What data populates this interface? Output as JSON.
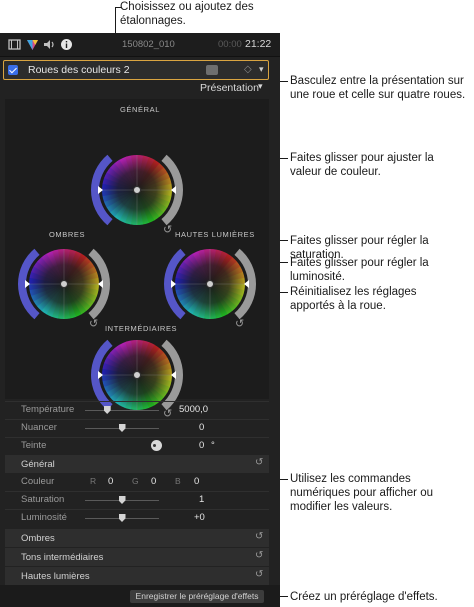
{
  "annotations": {
    "corrections": "Choisissez ou ajoutez des étalonnages.",
    "presentation": "Basculez entre la présentation sur une roue et celle sur quatre roues.",
    "color_value": "Faites glisser pour ajuster la valeur de couleur.",
    "saturation": "Faites glisser pour régler la saturation.",
    "luminosity": "Faites glisser pour régler la luminosité.",
    "reset": "Réinitialisez les réglages apportés à la roue.",
    "numeric": "Utilisez les commandes numériques pour afficher ou modifier les valeurs.",
    "preset": "Créez un préréglage d'effets."
  },
  "topbar": {
    "clip_name": "150802_010",
    "timecode_dim": "00:00",
    "timecode": "21:22",
    "icons": [
      "film-icon",
      "color-board-icon",
      "audio-icon",
      "info-icon"
    ]
  },
  "correction": {
    "label": "Roues des couleurs 2",
    "checked": true
  },
  "presentation_label": "Présentation",
  "wheels": {
    "general": "GÉNÉRAL",
    "shadows": "OMBRES",
    "highlights": "HAUTES LUMIÈRES",
    "midtones": "INTERMÉDIAIRES"
  },
  "params": {
    "temperature": {
      "label": "Température",
      "value": "5000,0",
      "level": 0.3
    },
    "tint": {
      "label": "Nuancer",
      "value": "0",
      "level": 0.5
    },
    "hue": {
      "label": "Teinte",
      "value": "0",
      "unit": "°"
    }
  },
  "general_section": {
    "title": "Général",
    "color": {
      "label": "Couleur",
      "r_label": "R",
      "r": "0",
      "g_label": "G",
      "g": "0",
      "b_label": "B",
      "b": "0"
    },
    "saturation": {
      "label": "Saturation",
      "value": "1",
      "level": 0.5
    },
    "luminosity": {
      "label": "Luminosité",
      "value": "+0",
      "level": 0.5
    }
  },
  "sections": {
    "shadows": "Ombres",
    "midtones": "Tons intermédiaires",
    "highlights": "Hautes lumières"
  },
  "footer": {
    "save_preset": "Enregistrer le préréglage d'effets"
  },
  "colors": {
    "accent_border": "#d9a441",
    "checkbox": "#3a6ee8",
    "panel_bg": "#222222"
  }
}
